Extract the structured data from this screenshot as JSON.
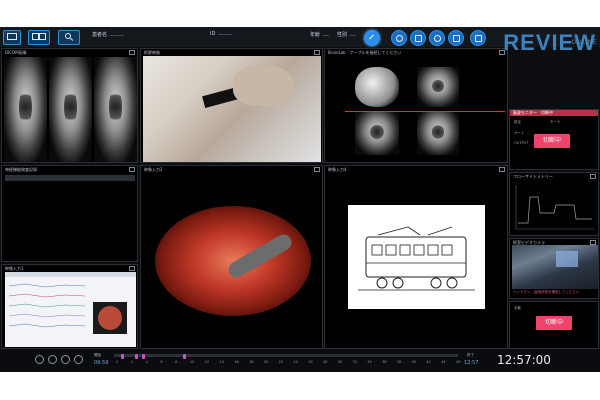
{
  "toolbar": {
    "patient_name_label": "患者名",
    "id_label": "ID",
    "age_label": "年齢",
    "sex_label": "性別",
    "online_label": "ONLINE"
  },
  "panels": {
    "dicom": {
      "title": "DICOM画像"
    },
    "operation_field": {
      "title": "術野映像"
    },
    "brainlab": {
      "title": "BrainLab　ケーブルを接続してください"
    },
    "vitals_log": {
      "title": "神経機能検査記録"
    },
    "monitor": {
      "title": "映像入力1"
    },
    "endoscope": {
      "title": "映像入力2"
    },
    "nerve": {
      "title": "映像入力3"
    },
    "schematic": {
      "title": "映像入力4"
    },
    "trend": {
      "title": "フローサイトメトリー"
    },
    "room_camera": {
      "title": "術室ビデオカメラ"
    },
    "pulse": {
      "title": "脳波モニター　切断中"
    }
  },
  "overlay": {
    "review_label": "REVIEW"
  },
  "status": {
    "disconnected_label": "切断中",
    "disconnected_label_2": "切断中"
  },
  "right_panel_fields": {
    "label_a": "設定",
    "label_b": "モード",
    "label_c": "オート",
    "label_d": "OUTPUT",
    "bottom_note": "ヘッドホン　接続状態を確認してください",
    "bottom_field": "手動"
  },
  "timeline": {
    "start_label": "開始",
    "start_time": "09:59",
    "end_label": "終了",
    "end_time": "12:57",
    "tick_numbers": [
      "0",
      "2",
      "4",
      "6",
      "8",
      "10",
      "12",
      "14",
      "16",
      "18",
      "20",
      "22",
      "24",
      "26",
      "28",
      "30",
      "32",
      "34",
      "36",
      "38",
      "40",
      "42",
      "44",
      "46"
    ],
    "marker_positions": [
      0.02,
      0.06,
      0.08,
      0.2
    ]
  },
  "clock": "12:57:00",
  "colors": {
    "accent": "#1c6fc0",
    "alert": "#f0436b",
    "review": "#3f89c8",
    "marker": "#d052c0"
  }
}
